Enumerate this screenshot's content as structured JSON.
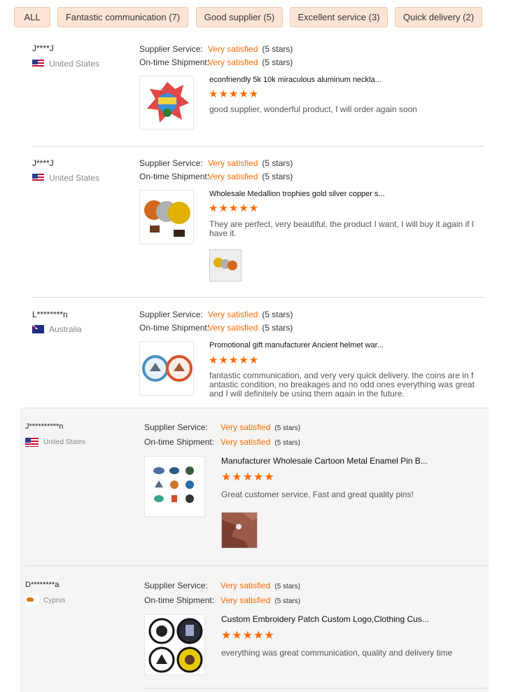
{
  "filters": [
    {
      "label": "ALL"
    },
    {
      "label": "Fantastic communication (7)"
    },
    {
      "label": "Good supplier (5)"
    },
    {
      "label": "Excellent service (3)"
    },
    {
      "label": "Quick delivery (2)"
    }
  ],
  "colors": {
    "accent": "#ff6a00",
    "pill_bg": "#fde5d6",
    "pill_border": "#f3c7ad"
  },
  "reviews": [
    {
      "user": "J****J",
      "country": "United States",
      "supplier_label": "Supplier Service:",
      "supplier_value": "Very satisfied",
      "supplier_stars": "(5 stars)",
      "shipment_label": "On-time Shipment:",
      "shipment_value": "Very satisfied",
      "shipment_stars": "(5 stars)",
      "product_title": "econfriendly 5k 10k miraculous aluminum neckla...",
      "rating": 5,
      "comment": "good supplier, wonderful product, I will order again soon"
    },
    {
      "user": "J****J",
      "country": "United States",
      "supplier_label": "Supplier Service:",
      "supplier_value": "Very satisfied",
      "supplier_stars": "(5 stars)",
      "shipment_label": "On-time Shipment:",
      "shipment_value": "Very satisfied",
      "shipment_stars": "(5 stars)",
      "product_title": "Wholesale Medallion trophies gold silver copper s...",
      "rating": 5,
      "comment": "They are perfect, very beautiful, the product I want, I will buy it again if I have it."
    },
    {
      "user": "L********n",
      "country": "Australia",
      "supplier_label": "Supplier Service:",
      "supplier_value": "Very satisfied",
      "supplier_stars": "(5 stars)",
      "shipment_label": "On-time Shipment:",
      "shipment_value": "Very satisfied",
      "shipment_stars": "(5 stars)",
      "product_title": "Promotional gift manufacturer Ancient helmet war...",
      "rating": 5,
      "comment": "fantastic communication, and very very quick delivery. the coins are in fantastic condition, no breakages and no odd ones everything was great and I will definitely be using them again in the future."
    },
    {
      "user": "J**********n",
      "country": "United States",
      "supplier_label": "Supplier Service:",
      "supplier_value": "Very satisfied",
      "supplier_stars": "(5 stars)",
      "shipment_label": "On-time Shipment:",
      "shipment_value": "Very satisfied",
      "shipment_stars": "(5 stars)",
      "product_title": "Manufacturer Wholesale Cartoon Metal Enamel Pin B...",
      "rating": 5,
      "comment": "Great customer service.  Fast and great quality pins!"
    },
    {
      "user": "D********a",
      "country": "Cyprus",
      "supplier_label": "Supplier Service:",
      "supplier_value": "Very satisfied",
      "supplier_stars": "(5 stars)",
      "shipment_label": "On-time Shipment:",
      "shipment_value": "Very satisfied",
      "shipment_stars": "(5 stars)",
      "product_title": "Custom Embroidery Patch Custom Logo,Clothing Cus...",
      "rating": 5,
      "comment": "everything was great communication, quality and delivery time"
    }
  ]
}
